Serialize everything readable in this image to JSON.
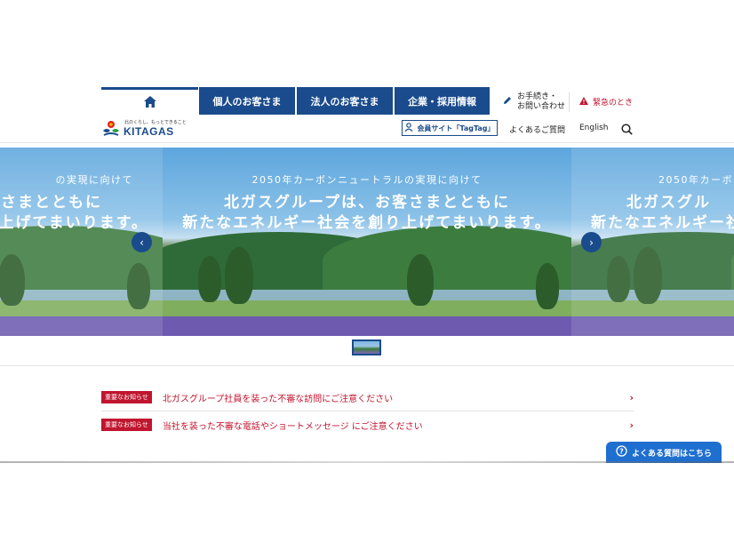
{
  "header": {
    "nav_tabs": [
      "個人のお客さま",
      "法人のお客さま",
      "企業・採用情報"
    ],
    "procedures_label_1": "お手続き・",
    "procedures_label_2": "お問い合わせ",
    "emergency_label": "緊急のとき",
    "member_site_label": "会員サイト「TagTag」",
    "faq_label": "よくあるご質問",
    "english_label": "English",
    "logo": {
      "tagline": "北のくらし、もっとできること",
      "wordmark": "KITAGAS"
    }
  },
  "hero": {
    "subtitle": "2050年カーボンニュートラルの実現に向けて",
    "line1": "北ガスグループは、お客さまとともに",
    "line2": "新たなエネルギー社会を創り上げてまいります。",
    "prev_fragment_sub": "の実現に向けて",
    "prev_fragment_line1": "さまとともに",
    "prev_fragment_line2": "上げてまいります。",
    "next_fragment_sub": "2050年カーボ",
    "next_fragment_line1": "北ガスグル",
    "next_fragment_line2": "新たなエネルギー社"
  },
  "notices": [
    {
      "badge": "重要なお知らせ",
      "text": "北ガスグループ社員を装った不審な訪問にご注意ください"
    },
    {
      "badge": "重要なお知らせ",
      "text": "当社を装った不審な電話やショートメッセージ にご注意ください"
    }
  ],
  "faq_float_label": "よくある質問はこちら",
  "colors": {
    "brand_blue": "#1a4b8c",
    "alert_red": "#c0152f",
    "faq_blue": "#1e6fd0"
  }
}
